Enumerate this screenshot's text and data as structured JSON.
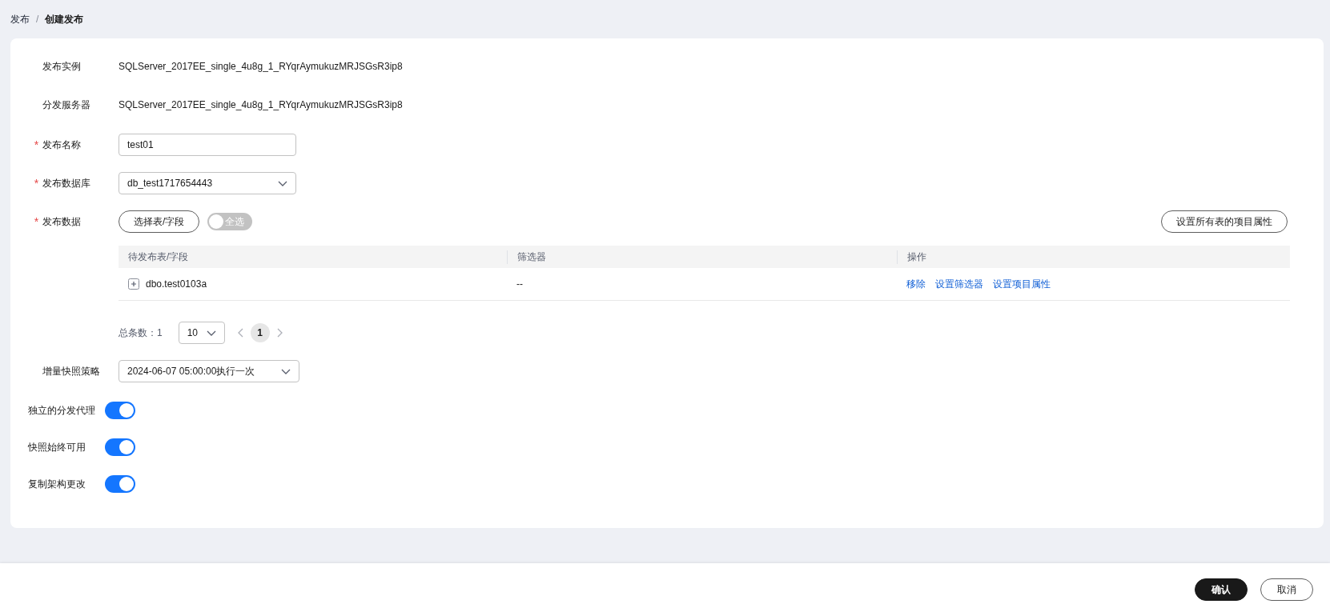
{
  "breadcrumb": [
    {
      "label": "发布",
      "current": false
    },
    {
      "label": "创建发布",
      "current": true
    }
  ],
  "breadcrumb_separator": "/",
  "required_mark": "*",
  "info_rows": [
    {
      "label": "发布实例",
      "value": "SQLServer_2017EE_single_4u8g_1_RYqrAymukuzMRJSGsR3ip8"
    },
    {
      "label": "分发服务器",
      "value": "SQLServer_2017EE_single_4u8g_1_RYqrAymukuzMRJSGsR3ip8"
    }
  ],
  "name_field": {
    "label": "发布名称",
    "required": true,
    "value": "test01"
  },
  "database_field": {
    "label": "发布数据库",
    "required": true,
    "value": "db_test1717654443"
  },
  "publish_data": {
    "label": "发布数据",
    "required": true,
    "select_button": "选择表/字段",
    "select_all": {
      "label": "全选",
      "on": false
    },
    "set_all_button": "设置所有表的项目属性",
    "table": {
      "columns": [
        "待发布表/字段",
        "筛选器",
        "操作"
      ],
      "rows": [
        {
          "name": "dbo.test0103a",
          "filter": "--",
          "actions": [
            "移除",
            "设置筛选器",
            "设置项目属性"
          ]
        }
      ]
    },
    "pagination": {
      "total_label": "总条数：",
      "total": "1",
      "page_size": "10",
      "pages": [
        {
          "label": "1",
          "selected": true
        }
      ]
    }
  },
  "snapshot_policy": {
    "label": "增量快照策略",
    "value": "2024-06-07 05:00:00执行一次"
  },
  "switches": [
    {
      "label": "独立的分发代理",
      "on": true
    },
    {
      "label": "快照始终可用",
      "on": true
    },
    {
      "label": "复制架构更改",
      "on": true
    }
  ],
  "footer_buttons": [
    {
      "label": "确认",
      "kind": "primary"
    },
    {
      "label": "取消",
      "kind": "secondary"
    }
  ]
}
